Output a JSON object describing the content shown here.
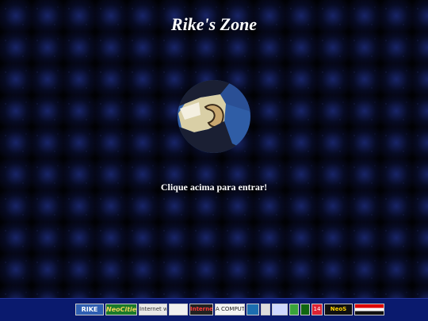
{
  "page": {
    "title": "Rike's Zone",
    "caption": "Clique acima para entrar!"
  },
  "enter_image": {
    "icon": "avatar-logo-icon",
    "colors": {
      "background": "#2f5da6",
      "face": "#d9cfa6",
      "hair": "#1a1f33"
    }
  },
  "footer": {
    "background": "#0a1a6e",
    "badges": [
      {
        "name": "rike-badge",
        "label": "RIKE"
      },
      {
        "name": "neocities-badge",
        "label": "NeoCities"
      },
      {
        "name": "internet-explorer-badge",
        "label": "Internet with"
      },
      {
        "name": "best-viewed-badge",
        "label": ""
      },
      {
        "name": "ie-badge",
        "label": "Internet EXPLO"
      },
      {
        "name": "computer-badge",
        "label": "A COMPUTER"
      },
      {
        "name": "windows-badge",
        "label": ""
      },
      {
        "name": "screen-badge",
        "label": ""
      },
      {
        "name": "box-badge",
        "label": ""
      },
      {
        "name": "green-badge-1",
        "label": ""
      },
      {
        "name": "green-badge-2",
        "label": ""
      },
      {
        "name": "number-badge",
        "label": "14"
      },
      {
        "name": "neos-badge",
        "label": "NeoS"
      },
      {
        "name": "flag-badge",
        "label": ""
      }
    ]
  }
}
